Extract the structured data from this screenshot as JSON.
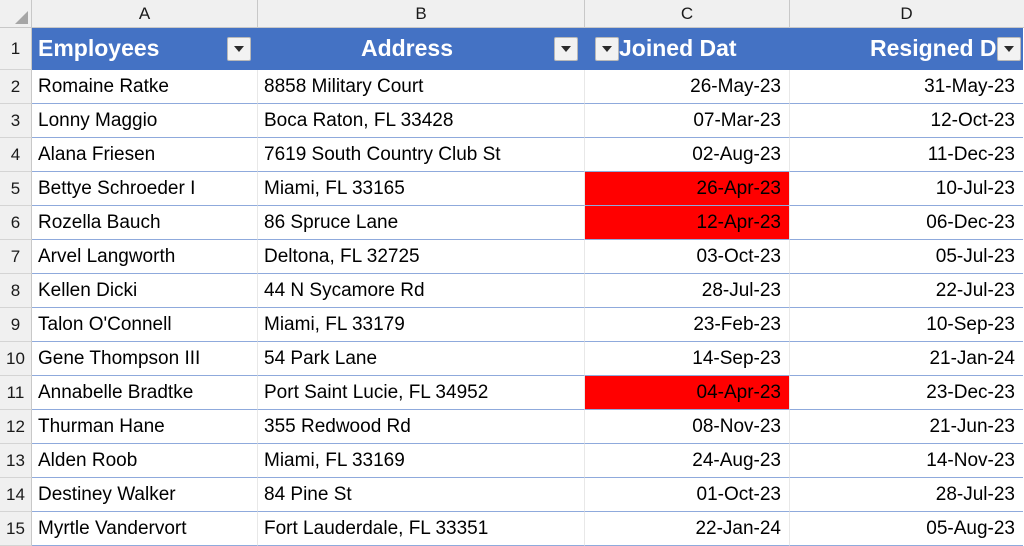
{
  "app": {
    "type": "spreadsheet",
    "select_all_icon": "select-all-triangle-icon"
  },
  "columns": {
    "letters": [
      "A",
      "B",
      "C",
      "D"
    ]
  },
  "row_numbers": [
    "1",
    "2",
    "3",
    "4",
    "5",
    "6",
    "7",
    "8",
    "9",
    "10",
    "11",
    "12",
    "13",
    "14",
    "15"
  ],
  "table": {
    "header_fill": "#4472C4",
    "header_text_color": "#FFFFFF",
    "highlight_fill": "#FF0000",
    "headers": [
      {
        "label": "Employees",
        "filter_icon": "filter-dropdown-icon"
      },
      {
        "label": "Address",
        "filter_icon": "filter-dropdown-icon"
      },
      {
        "label": "Joined Dat",
        "filter_icon": "filter-dropdown-icon"
      },
      {
        "label": "Resigned Dat",
        "filter_icon": "filter-dropdown-icon"
      }
    ],
    "rows": [
      {
        "employee": "Romaine Ratke",
        "address": "8858 Military Court",
        "joined": "26-May-23",
        "resigned": "31-May-23",
        "joined_highlight": false
      },
      {
        "employee": "Lonny Maggio",
        "address": "Boca Raton, FL 33428",
        "joined": "07-Mar-23",
        "resigned": "12-Oct-23",
        "joined_highlight": false
      },
      {
        "employee": "Alana Friesen",
        "address": "7619 South Country Club St",
        "joined": "02-Aug-23",
        "resigned": "11-Dec-23",
        "joined_highlight": false
      },
      {
        "employee": "Bettye Schroeder I",
        "address": "Miami, FL 33165",
        "joined": "26-Apr-23",
        "resigned": "10-Jul-23",
        "joined_highlight": true
      },
      {
        "employee": "Rozella Bauch",
        "address": "86 Spruce Lane",
        "joined": "12-Apr-23",
        "resigned": "06-Dec-23",
        "joined_highlight": true
      },
      {
        "employee": "Arvel Langworth",
        "address": "Deltona, FL 32725",
        "joined": "03-Oct-23",
        "resigned": "05-Jul-23",
        "joined_highlight": false
      },
      {
        "employee": "Kellen Dicki",
        "address": "44 N Sycamore Rd",
        "joined": "28-Jul-23",
        "resigned": "22-Jul-23",
        "joined_highlight": false
      },
      {
        "employee": "Talon O'Connell",
        "address": "Miami, FL 33179",
        "joined": "23-Feb-23",
        "resigned": "10-Sep-23",
        "joined_highlight": false
      },
      {
        "employee": "Gene Thompson III",
        "address": "54 Park Lane",
        "joined": "14-Sep-23",
        "resigned": "21-Jan-24",
        "joined_highlight": false
      },
      {
        "employee": "Annabelle Bradtke",
        "address": "Port Saint Lucie, FL 34952",
        "joined": "04-Apr-23",
        "resigned": "23-Dec-23",
        "joined_highlight": true
      },
      {
        "employee": "Thurman Hane",
        "address": "355 Redwood Rd",
        "joined": "08-Nov-23",
        "resigned": "21-Jun-23",
        "joined_highlight": false
      },
      {
        "employee": "Alden Roob",
        "address": "Miami, FL 33169",
        "joined": "24-Aug-23",
        "resigned": "14-Nov-23",
        "joined_highlight": false
      },
      {
        "employee": "Destiney Walker",
        "address": "84 Pine St",
        "joined": "01-Oct-23",
        "resigned": "28-Jul-23",
        "joined_highlight": false
      },
      {
        "employee": "Myrtle Vandervort",
        "address": "Fort Lauderdale, FL 33351",
        "joined": "22-Jan-24",
        "resigned": "05-Aug-23",
        "joined_highlight": false
      }
    ]
  }
}
